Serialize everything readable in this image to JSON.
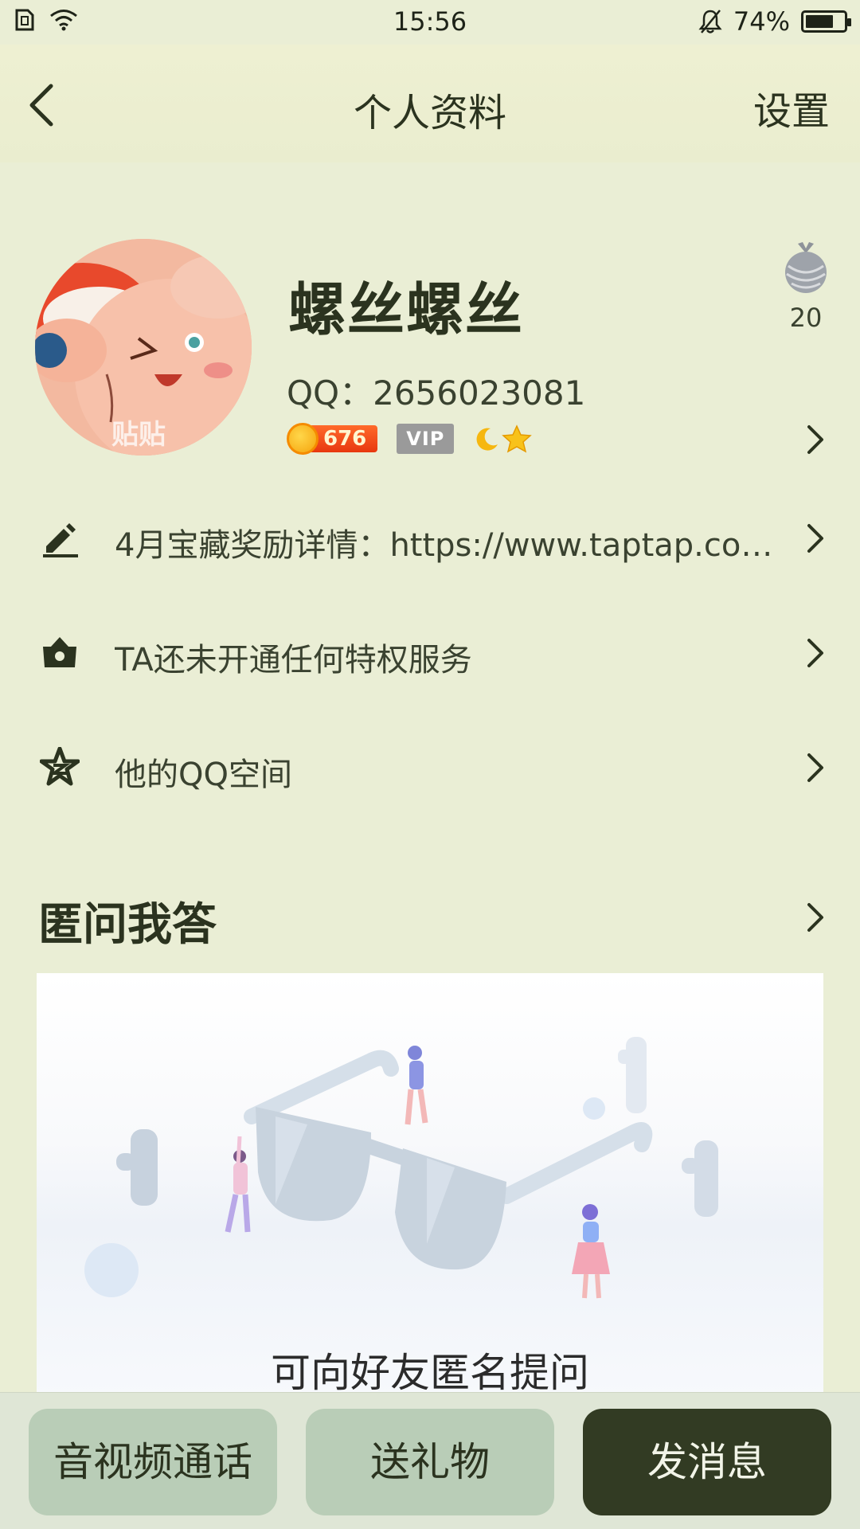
{
  "status_bar": {
    "time": "15:56",
    "battery_percent": "74%",
    "battery_level": 0.74,
    "icons": [
      "sim-icon",
      "wifi-icon",
      "bell-muted-icon",
      "battery-icon"
    ]
  },
  "nav": {
    "title": "个人资料",
    "settings_label": "设置",
    "back_icon": "back-arrow-icon"
  },
  "profile": {
    "avatar_caption": "贴贴",
    "nickname": "螺丝螺丝",
    "qq_number": "QQ：2656023081",
    "coin_level": "676",
    "vip_label": "VIP",
    "gift_count": "20",
    "level_icons": [
      "moon-icon",
      "star-icon"
    ]
  },
  "rows": [
    {
      "icon": "pencil-icon",
      "text": "4月宝藏奖励详情：https://www.taptap.com/..."
    },
    {
      "icon": "crown-icon",
      "text": "TA还未开通任何特权服务"
    },
    {
      "icon": "qzone-star-icon",
      "text": "他的QQ空间"
    }
  ],
  "section": {
    "title": "匿问我答",
    "card_text": "可向好友匿名提问"
  },
  "bottom_actions": {
    "call_label": "音视频通话",
    "gift_label": "送礼物",
    "message_label": "发消息"
  },
  "colors": {
    "background": "#eaeed5",
    "primary_dark": "#323b23",
    "button_light": "#b9cdb7",
    "coin_badge": "#e8380f"
  }
}
